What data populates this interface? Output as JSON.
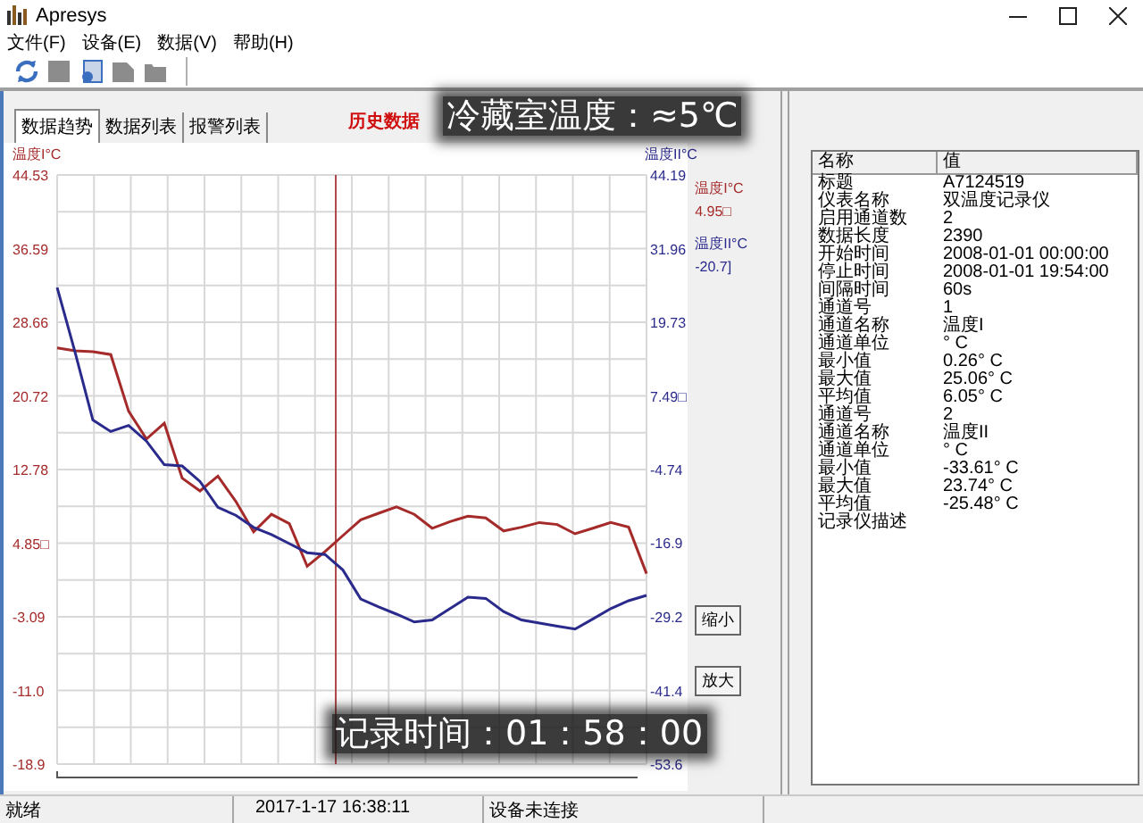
{
  "window": {
    "title": "Apresys"
  },
  "menu": [
    "文件(F)",
    "设备(E)",
    "数据(V)",
    "帮助(H)"
  ],
  "toolbar": [
    {
      "kind": "refresh",
      "disabled": false
    },
    {
      "kind": "stop",
      "disabled": true
    },
    {
      "kind": "import",
      "disabled": false
    },
    {
      "kind": "page",
      "disabled": true
    },
    {
      "kind": "folder",
      "disabled": true
    }
  ],
  "tabs": [
    {
      "label": "数据趋势",
      "selected": true
    },
    {
      "label": "数据列表",
      "selected": false
    },
    {
      "label": "报警列表",
      "selected": false
    }
  ],
  "panel_title": "历史数据",
  "chart": {
    "legend": [
      {
        "name": "温度I°C",
        "value": "4.95□",
        "color": "#a52a2a"
      },
      {
        "name": "温度II°C",
        "value": "-20.7]",
        "color": "#2a2a8c"
      }
    ],
    "buttons": [
      "缩小",
      "放大"
    ],
    "channel_1": {
      "chart_data": {
        "type": "line",
        "ylabel": "温度I°C",
        "grid": true,
        "ylim": [
          -18.9,
          44.53
        ],
        "yticks": [
          44.53,
          36.59,
          28.66,
          20.72,
          12.78,
          {
            "value": 4.85,
            "label": "4.85□"
          },
          -3.09,
          {
            "value": -11,
            "label": "-11.0"
          },
          -18.9
        ],
        "categories": [
          null,
          null,
          null,
          null,
          null,
          null,
          null,
          null,
          null,
          null,
          null,
          null,
          null,
          null,
          null,
          null,
          null,
          null,
          null,
          null,
          null,
          null,
          null,
          null,
          null,
          null,
          null,
          null,
          null,
          null,
          null,
          null,
          null,
          null
        ],
        "series": [
          {
            "color": "#a52a2a",
            "values": [
              25.9,
              25.6,
              25.5,
              25.2,
              19.1,
              16.1,
              17.8,
              11.9,
              10.5,
              12.1,
              9.4,
              6.1,
              8.0,
              7.0,
              2.4,
              4.0,
              5.7,
              7.4,
              8.1,
              8.8,
              8.0,
              6.5,
              7.2,
              7.8,
              7.6,
              6.2,
              6.6,
              7.1,
              6.9,
              5.9,
              6.5,
              7.1,
              6.6,
              1.6
            ]
          }
        ]
      }
    },
    "channel_2": {
      "chart_data": {
        "type": "line",
        "ylabel": "温度II°C",
        "ylim": [
          -53.6,
          44.19
        ],
        "yticks": [
          44.19,
          31.96,
          19.73,
          {
            "value": 7.49,
            "label": "7.49□"
          },
          -4.74,
          -16.9,
          -29.2,
          -41.4,
          -53.6
        ],
        "categories": [
          null,
          null,
          null,
          null,
          null,
          null,
          null,
          null,
          null,
          null,
          null,
          null,
          null,
          null,
          null,
          null,
          null,
          null,
          null,
          null,
          null,
          null,
          null,
          null,
          null,
          null,
          null,
          null,
          null,
          null,
          null,
          null,
          null,
          null
        ],
        "series": [
          {
            "color": "#2a2a8c",
            "values": [
              25.5,
              14.8,
              3.5,
              1.6,
              2.6,
              0.0,
              -3.9,
              -4.1,
              -6.7,
              -11.0,
              -12.3,
              -14.3,
              -15.5,
              -17.0,
              -18.5,
              -18.8,
              -21.4,
              -26.2,
              -27.5,
              -28.7,
              -30.0,
              -29.7,
              -27.8,
              -25.9,
              -26.1,
              -28.3,
              -29.7,
              -30.2,
              -30.7,
              -31.2,
              -29.5,
              -27.8,
              -26.5,
              -25.6
            ]
          }
        ]
      }
    }
  },
  "info_table": {
    "columns": [
      "名称",
      "值"
    ],
    "rows": [
      {
        "name": "标题",
        "value": "A7124519"
      },
      {
        "name": "仪表名称",
        "value": "双温度记录仪"
      },
      {
        "name": "启用通道数",
        "value": "2"
      },
      {
        "name": "数据长度",
        "value": "2390"
      },
      {
        "name": "开始时间",
        "value": "2008-01-01 00:00:00"
      },
      {
        "name": "停止时间",
        "value": "2008-01-01 19:54:00"
      },
      {
        "name": "间隔时间",
        "value": "60s"
      },
      {
        "name": "通道号",
        "value": "1"
      },
      {
        "name": "通道名称",
        "value": "温度I"
      },
      {
        "name": "通道单位",
        "value": "° C"
      },
      {
        "name": "最小值",
        "value": "0.26° C"
      },
      {
        "name": "最大值",
        "value": "25.06° C"
      },
      {
        "name": "平均值",
        "value": "6.05° C"
      },
      {
        "name": "通道号",
        "value": "2"
      },
      {
        "name": "通道名称",
        "value": "温度II"
      },
      {
        "name": "通道单位",
        "value": "° C"
      },
      {
        "name": "最小值",
        "value": "-33.61° C"
      },
      {
        "name": "最大值",
        "value": "23.74° C"
      },
      {
        "name": "平均值",
        "value": "-25.48° C"
      },
      {
        "name": "记录仪描述"
      }
    ]
  },
  "status_bar": [
    "就绪",
    "2017-1-17 16:38:11",
    "设备未连接"
  ],
  "captions": [
    "冷藏室温度：≈5℃",
    "记录时间：01：58：00"
  ]
}
